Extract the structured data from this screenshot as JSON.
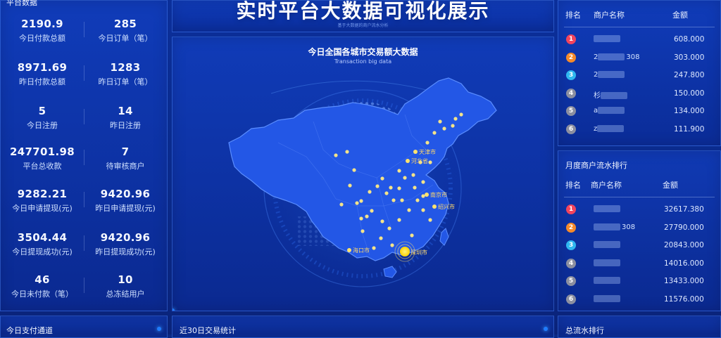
{
  "left_panel_title_fragment": "平台数据",
  "stats": [
    {
      "value": "2190.9",
      "label": "今日付款总额"
    },
    {
      "value": "285",
      "label": "今日订单（笔）"
    },
    {
      "value": "8971.69",
      "label": "昨日付款总额"
    },
    {
      "value": "1283",
      "label": "昨日订单（笔）"
    },
    {
      "value": "5",
      "label": "今日注册"
    },
    {
      "value": "14",
      "label": "昨日注册"
    },
    {
      "value": "247701.98",
      "label": "平台总收款"
    },
    {
      "value": "7",
      "label": "待审核商户"
    },
    {
      "value": "9282.21",
      "label": "今日申请提现(元)"
    },
    {
      "value": "9420.96",
      "label": "昨日申请提现(元)"
    },
    {
      "value": "3504.44",
      "label": "今日提现成功(元)"
    },
    {
      "value": "9420.96",
      "label": "昨日提现成功(元)"
    },
    {
      "value": "46",
      "label": "今日未付款（笔）"
    },
    {
      "value": "10",
      "label": "总冻结用户"
    }
  ],
  "header": {
    "title": "实时平台大数据可视化展示",
    "subtitle": "基于大数据的商户流水分析"
  },
  "map": {
    "title": "今日全国各城市交易额大数据",
    "subtitle": "Transaction big data",
    "cities": [
      {
        "name": "天津市"
      },
      {
        "name": "河北省"
      },
      {
        "name": "南京市"
      },
      {
        "name": "绍兴市"
      },
      {
        "name": "海口市"
      },
      {
        "name": "深圳市"
      }
    ]
  },
  "rank_top": {
    "headers": {
      "rank": "排名",
      "name": "商户名称",
      "amount": "金额"
    },
    "rows": [
      {
        "rank": "1",
        "name_suffix": "",
        "amount": "608.000"
      },
      {
        "rank": "2",
        "name_prefix": "2",
        "name_suffix": "308",
        "amount": "303.000"
      },
      {
        "rank": "3",
        "name_prefix": "2",
        "name_suffix": "",
        "amount": "247.800"
      },
      {
        "rank": "4",
        "name_prefix": "杉",
        "name_suffix": "",
        "amount": "150.000"
      },
      {
        "rank": "5",
        "name_prefix": "a",
        "name_suffix": "",
        "amount": "134.000"
      },
      {
        "rank": "6",
        "name_prefix": "z",
        "name_suffix": "",
        "amount": "111.900"
      }
    ]
  },
  "rank_month": {
    "title": "月度商户流水排行",
    "headers": {
      "rank": "排名",
      "name": "商户名称",
      "amount": "金额"
    },
    "rows": [
      {
        "rank": "1",
        "name_suffix": "",
        "amount": "32617.380"
      },
      {
        "rank": "2",
        "name_suffix": "308",
        "amount": "27790.000"
      },
      {
        "rank": "3",
        "name_suffix": "",
        "amount": "20843.000"
      },
      {
        "rank": "4",
        "name_suffix": "",
        "amount": "14016.000"
      },
      {
        "rank": "5",
        "name_suffix": "",
        "amount": "13433.000"
      },
      {
        "rank": "6",
        "name_suffix": "",
        "amount": "11576.000"
      }
    ]
  },
  "bottom": {
    "left_title": "今日支付通道",
    "mid_title": "近30日交易统计",
    "right_title": "总流水排行"
  },
  "colors": {
    "rank1": "#f2445d",
    "rank2": "#f58a2a",
    "rank3": "#2fb7f0",
    "rank_other": "#8c8fa0",
    "accent": "#1f7cff",
    "city": "#ffe26e"
  }
}
